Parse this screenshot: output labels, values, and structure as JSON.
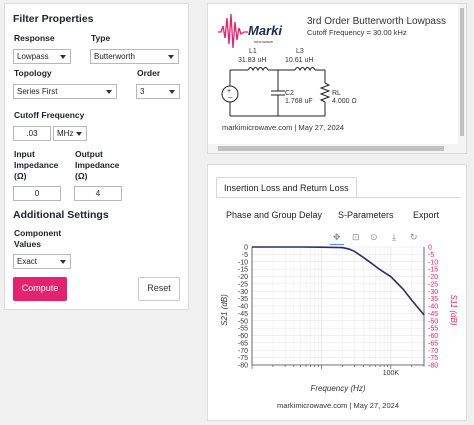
{
  "filter_properties": {
    "title": "Filter Properties",
    "response_label": "Response",
    "response_value": "Lowpass",
    "type_label": "Type",
    "type_value": "Butterworth",
    "topology_label": "Topology",
    "topology_value": "Series First",
    "order_label": "Order",
    "order_value": "3",
    "cutoff_label": "Cutoff Frequency",
    "cutoff_value": ".03",
    "cutoff_unit": "MHz",
    "input_impedance_label": [
      "Input",
      "Impedance",
      "(Ω)"
    ],
    "input_impedance_value": "0",
    "output_impedance_label": [
      "Output",
      "Impedance",
      "(Ω)"
    ],
    "output_impedance_value": "4"
  },
  "additional_settings": {
    "title": "Additional Settings",
    "component_values_label": [
      "Component",
      "Values"
    ],
    "component_values_value": "Exact"
  },
  "buttons": {
    "compute": "Compute",
    "reset": "Reset"
  },
  "schematic": {
    "logo_text": "Marki",
    "logo_subtext": "microwave",
    "title": "3rd Order Butterworth Lowpass",
    "subtitle": "Cutoff Frequency = 30.00 kHz",
    "l1_name": "L1",
    "l1_value": "31.83 uH",
    "l3_name": "L3",
    "l3_value": "10.61 uH",
    "c2_name": "C2",
    "c2_value": "1.768 uF",
    "rl_name": "RL",
    "rl_value": "4.000 Ω",
    "footer": "markimicrowave.com | May 27, 2024"
  },
  "tabs": {
    "insertion_loss": "Insertion Loss and Return Loss",
    "phase_delay": "Phase and Group Delay",
    "s_parameters": "S-Parameters",
    "export": "Export"
  },
  "toolbar_icons": [
    "move-icon",
    "zoom-box-icon",
    "zoom-pan-icon",
    "download-icon",
    "reset-icon"
  ],
  "colors": {
    "accent": "#e6216e",
    "s21_line": "#2c2c6e",
    "s11_axis": "#e6216e"
  },
  "chart_data": {
    "type": "line",
    "xlabel": "Frequency (Hz)",
    "ylabel": "S21 (dB)",
    "y2label": "S11 (dB)",
    "x_tick_labels": [
      "100K"
    ],
    "x_log": true,
    "xlim": [
      1000,
      300000
    ],
    "ylim": [
      -80,
      0
    ],
    "y_ticks": [
      0,
      -5,
      -10,
      -15,
      -20,
      -25,
      -30,
      -35,
      -40,
      -45,
      -50,
      -55,
      -60,
      -65,
      -70,
      -75,
      -80
    ],
    "y2_ticks": [
      0,
      -5,
      -10,
      -15,
      -20,
      -25,
      -30,
      -35,
      -40,
      -45,
      -50,
      -55,
      -60,
      -65,
      -70,
      -75,
      -80
    ],
    "grid": true,
    "series": [
      {
        "name": "S21",
        "x": [
          1000,
          2000,
          5000,
          10000,
          15000,
          20000,
          25000,
          30000,
          40000,
          50000,
          70000,
          100000,
          150000,
          200000,
          300000
        ],
        "values": [
          0,
          0,
          0,
          -0.1,
          -0.3,
          -0.4,
          -1.4,
          -3.0,
          -7.0,
          -10.3,
          -15.4,
          -20.1,
          -28.6,
          -36.1,
          -46.0
        ]
      }
    ],
    "footer": "markimicrowave.com | May 27, 2024"
  }
}
